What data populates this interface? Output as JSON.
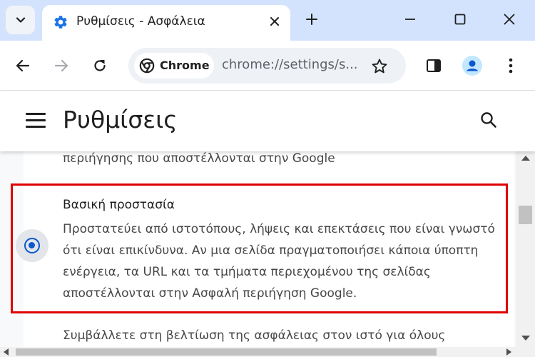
{
  "tab": {
    "title": "Ρυθμίσεις - Ασφάλεια",
    "favicon": "gear-icon"
  },
  "toolbar": {
    "chip_label": "Chrome",
    "url": "chrome://settings/security",
    "url_display": "chrome://settings/s..."
  },
  "settings": {
    "title": "Ρυθμίσεις"
  },
  "content": {
    "top_text": "περιήγησης που αποστέλλονται στην Google",
    "option_title": "Βασική προστασία",
    "option_desc": "Προστατεύει από ιστοτόπους, λήψεις και επεκτάσεις που είναι γνωστό ότι είναι επικίνδυνα. Αν μια σελίδα πραγματοποιήσει κάποια ύποπτη ενέργεια, τα URL και τα τμήματα περιεχομένου της σελίδας αποστέλλονται στην Ασφαλή περιήγηση Google.",
    "option_selected": true,
    "next_text": "Συμβάλλετε στη βελτίωση της ασφάλειας στον ιστό για όλους"
  },
  "colors": {
    "tabstrip": "#d3e3fd",
    "accent": "#0b57d0",
    "highlight": "#e00000"
  }
}
